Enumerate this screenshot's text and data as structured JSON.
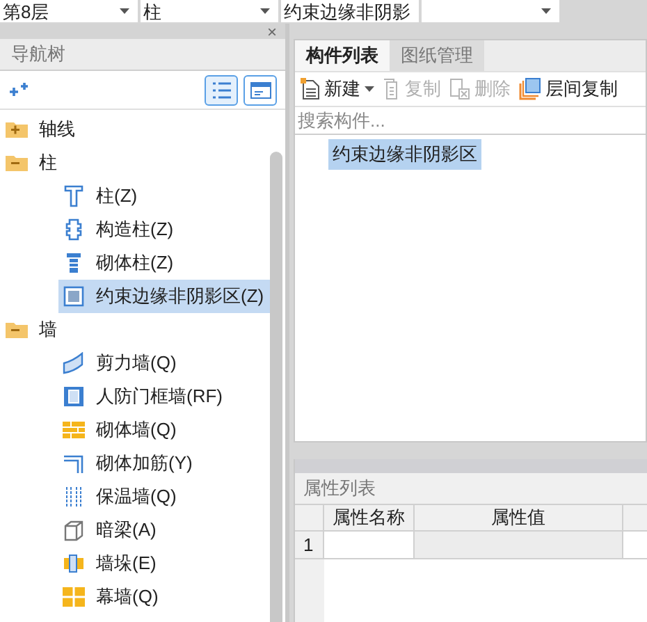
{
  "selectors": [
    {
      "value": "第8层"
    },
    {
      "value": "柱"
    },
    {
      "value": "约束边缘非阴影"
    }
  ],
  "nav": {
    "close": "×",
    "title": "导航树",
    "tree": [
      {
        "label": "轴线",
        "expanded": false,
        "selected": false
      },
      {
        "label": "柱",
        "expanded": true,
        "selected": false,
        "children": [
          {
            "label": "柱(Z)",
            "kind": "column",
            "selected": false
          },
          {
            "label": "构造柱(Z)",
            "kind": "construct",
            "selected": false
          },
          {
            "label": "砌体柱(Z)",
            "kind": "masonry-column",
            "selected": false
          },
          {
            "label": "约束边缘非阴影区(Z)",
            "kind": "hatched",
            "selected": true
          }
        ]
      },
      {
        "label": "墙",
        "expanded": true,
        "selected": false,
        "children": [
          {
            "label": "剪力墙(Q)",
            "kind": "shear",
            "selected": false
          },
          {
            "label": "人防门框墙(RF)",
            "kind": "frame",
            "selected": false
          },
          {
            "label": "砌体墙(Q)",
            "kind": "brick",
            "selected": false
          },
          {
            "label": "砌体加筋(Y)",
            "kind": "rebar",
            "selected": false
          },
          {
            "label": "保温墙(Q)",
            "kind": "insulation",
            "selected": false
          },
          {
            "label": "暗梁(A)",
            "kind": "beam",
            "selected": false
          },
          {
            "label": "墙垛(E)",
            "kind": "pier",
            "selected": false
          },
          {
            "label": "幕墙(Q)",
            "kind": "curtain",
            "selected": false
          }
        ]
      }
    ]
  },
  "component_panel": {
    "tabs": [
      {
        "label": "构件列表",
        "selected": true
      },
      {
        "label": "图纸管理",
        "selected": false
      }
    ],
    "toolbar": [
      {
        "label": "新建",
        "kind": "new",
        "disabled": false,
        "dropdown": true
      },
      {
        "label": "复制",
        "kind": "copy",
        "disabled": true,
        "dropdown": false
      },
      {
        "label": "删除",
        "kind": "delete",
        "disabled": true,
        "dropdown": false
      },
      {
        "label": "层间复制",
        "kind": "floor-copy",
        "disabled": false,
        "dropdown": false
      }
    ],
    "search": {
      "placeholder": "搜索构件..."
    },
    "items": [
      {
        "label": "约束边缘非阴影区",
        "selected": true
      }
    ]
  },
  "properties": {
    "title": "属性列表",
    "columns": [
      "属性名称",
      "属性值"
    ],
    "rows": [
      {
        "index": "1"
      }
    ]
  }
}
